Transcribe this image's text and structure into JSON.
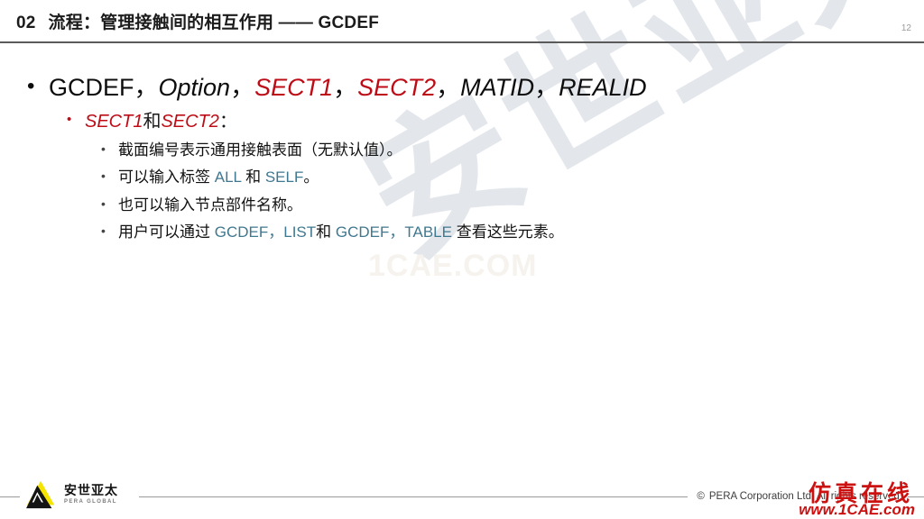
{
  "header": {
    "section_number": "02",
    "title": "流程：管理接触间的相互作用 —— GCDEF",
    "page_number": "12"
  },
  "content": {
    "bullet_glyph": "•",
    "level1": {
      "parts": [
        {
          "text": "GCDEF",
          "style": "plain"
        },
        {
          "text": "，",
          "style": "plain"
        },
        {
          "text": "Option",
          "style": "italic"
        },
        {
          "text": "，",
          "style": "plain"
        },
        {
          "text": "SECT1",
          "style": "italic-red"
        },
        {
          "text": "，",
          "style": "plain"
        },
        {
          "text": "SECT2",
          "style": "italic-red"
        },
        {
          "text": "，",
          "style": "plain"
        },
        {
          "text": "MATID",
          "style": "italic"
        },
        {
          "text": "，",
          "style": "plain"
        },
        {
          "text": "REALID",
          "style": "italic"
        }
      ],
      "p0": "GCDEF",
      "sep1": "，",
      "p1": "Option",
      "sep2": "，",
      "p2": "SECT1",
      "sep3": "，",
      "p3": "SECT2",
      "sep4": "，",
      "p4": "MATID",
      "sep5": "，",
      "p5": "REALID"
    },
    "level2": {
      "sect1": "SECT1",
      "he": "和",
      "sect2": "SECT2",
      "colon": "："
    },
    "level3": [
      {
        "id": "bullet-section-number",
        "segments": [
          {
            "text": "截面编号表示通用接触表面（无默认值）。",
            "style": "plain"
          }
        ],
        "s0": "截面编号表示通用接触表面（无默认值）。"
      },
      {
        "id": "bullet-labels",
        "s0": "可以输入标签 ",
        "s1": "ALL",
        "s2": " 和 ",
        "s3": "SELF",
        "s4": "。"
      },
      {
        "id": "bullet-node-component",
        "s0": "也可以输入节点部件名称。"
      },
      {
        "id": "bullet-list-table",
        "s0": "用户可以通过 ",
        "s1": "GCDEF，LIST",
        "s2": "和 ",
        "s3": "GCDEF，TABLE",
        "s4": " 查看这些元素。"
      }
    ]
  },
  "footer": {
    "logo_cn": "安世亚太",
    "logo_en": "PERA GLOBAL",
    "copyright_mark": "©",
    "copyright": "PERA Corporation Ltd. All rights reserved."
  },
  "watermarks": {
    "diagonal": "安世亚太",
    "faint": "1CAE.COM",
    "red_cn": "仿真在线",
    "red_url": "www.1CAE.com"
  },
  "colors": {
    "accent_red": "#bd0c16",
    "accent_blue": "#40788f",
    "rule_dark": "#5a5a5a",
    "rule_light": "#9a9a9a",
    "watermark_gray": "#e3e7ec",
    "logo_yellow": "#f5e400",
    "logo_black": "#141414",
    "brand_red": "#cc1111"
  }
}
